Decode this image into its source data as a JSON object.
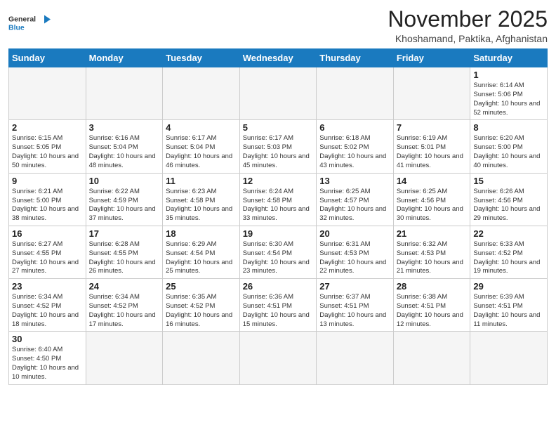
{
  "header": {
    "logo_general": "General",
    "logo_blue": "Blue",
    "month_title": "November 2025",
    "location": "Khoshamand, Paktika, Afghanistan"
  },
  "days_of_week": [
    "Sunday",
    "Monday",
    "Tuesday",
    "Wednesday",
    "Thursday",
    "Friday",
    "Saturday"
  ],
  "weeks": [
    [
      {
        "day": "",
        "info": ""
      },
      {
        "day": "",
        "info": ""
      },
      {
        "day": "",
        "info": ""
      },
      {
        "day": "",
        "info": ""
      },
      {
        "day": "",
        "info": ""
      },
      {
        "day": "",
        "info": ""
      },
      {
        "day": "1",
        "info": "Sunrise: 6:14 AM\nSunset: 5:06 PM\nDaylight: 10 hours and 52 minutes."
      }
    ],
    [
      {
        "day": "2",
        "info": "Sunrise: 6:15 AM\nSunset: 5:05 PM\nDaylight: 10 hours and 50 minutes."
      },
      {
        "day": "3",
        "info": "Sunrise: 6:16 AM\nSunset: 5:04 PM\nDaylight: 10 hours and 48 minutes."
      },
      {
        "day": "4",
        "info": "Sunrise: 6:17 AM\nSunset: 5:04 PM\nDaylight: 10 hours and 46 minutes."
      },
      {
        "day": "5",
        "info": "Sunrise: 6:17 AM\nSunset: 5:03 PM\nDaylight: 10 hours and 45 minutes."
      },
      {
        "day": "6",
        "info": "Sunrise: 6:18 AM\nSunset: 5:02 PM\nDaylight: 10 hours and 43 minutes."
      },
      {
        "day": "7",
        "info": "Sunrise: 6:19 AM\nSunset: 5:01 PM\nDaylight: 10 hours and 41 minutes."
      },
      {
        "day": "8",
        "info": "Sunrise: 6:20 AM\nSunset: 5:00 PM\nDaylight: 10 hours and 40 minutes."
      }
    ],
    [
      {
        "day": "9",
        "info": "Sunrise: 6:21 AM\nSunset: 5:00 PM\nDaylight: 10 hours and 38 minutes."
      },
      {
        "day": "10",
        "info": "Sunrise: 6:22 AM\nSunset: 4:59 PM\nDaylight: 10 hours and 37 minutes."
      },
      {
        "day": "11",
        "info": "Sunrise: 6:23 AM\nSunset: 4:58 PM\nDaylight: 10 hours and 35 minutes."
      },
      {
        "day": "12",
        "info": "Sunrise: 6:24 AM\nSunset: 4:58 PM\nDaylight: 10 hours and 33 minutes."
      },
      {
        "day": "13",
        "info": "Sunrise: 6:25 AM\nSunset: 4:57 PM\nDaylight: 10 hours and 32 minutes."
      },
      {
        "day": "14",
        "info": "Sunrise: 6:25 AM\nSunset: 4:56 PM\nDaylight: 10 hours and 30 minutes."
      },
      {
        "day": "15",
        "info": "Sunrise: 6:26 AM\nSunset: 4:56 PM\nDaylight: 10 hours and 29 minutes."
      }
    ],
    [
      {
        "day": "16",
        "info": "Sunrise: 6:27 AM\nSunset: 4:55 PM\nDaylight: 10 hours and 27 minutes."
      },
      {
        "day": "17",
        "info": "Sunrise: 6:28 AM\nSunset: 4:55 PM\nDaylight: 10 hours and 26 minutes."
      },
      {
        "day": "18",
        "info": "Sunrise: 6:29 AM\nSunset: 4:54 PM\nDaylight: 10 hours and 25 minutes."
      },
      {
        "day": "19",
        "info": "Sunrise: 6:30 AM\nSunset: 4:54 PM\nDaylight: 10 hours and 23 minutes."
      },
      {
        "day": "20",
        "info": "Sunrise: 6:31 AM\nSunset: 4:53 PM\nDaylight: 10 hours and 22 minutes."
      },
      {
        "day": "21",
        "info": "Sunrise: 6:32 AM\nSunset: 4:53 PM\nDaylight: 10 hours and 21 minutes."
      },
      {
        "day": "22",
        "info": "Sunrise: 6:33 AM\nSunset: 4:52 PM\nDaylight: 10 hours and 19 minutes."
      }
    ],
    [
      {
        "day": "23",
        "info": "Sunrise: 6:34 AM\nSunset: 4:52 PM\nDaylight: 10 hours and 18 minutes."
      },
      {
        "day": "24",
        "info": "Sunrise: 6:34 AM\nSunset: 4:52 PM\nDaylight: 10 hours and 17 minutes."
      },
      {
        "day": "25",
        "info": "Sunrise: 6:35 AM\nSunset: 4:52 PM\nDaylight: 10 hours and 16 minutes."
      },
      {
        "day": "26",
        "info": "Sunrise: 6:36 AM\nSunset: 4:51 PM\nDaylight: 10 hours and 15 minutes."
      },
      {
        "day": "27",
        "info": "Sunrise: 6:37 AM\nSunset: 4:51 PM\nDaylight: 10 hours and 13 minutes."
      },
      {
        "day": "28",
        "info": "Sunrise: 6:38 AM\nSunset: 4:51 PM\nDaylight: 10 hours and 12 minutes."
      },
      {
        "day": "29",
        "info": "Sunrise: 6:39 AM\nSunset: 4:51 PM\nDaylight: 10 hours and 11 minutes."
      }
    ],
    [
      {
        "day": "30",
        "info": "Sunrise: 6:40 AM\nSunset: 4:50 PM\nDaylight: 10 hours and 10 minutes."
      },
      {
        "day": "",
        "info": ""
      },
      {
        "day": "",
        "info": ""
      },
      {
        "day": "",
        "info": ""
      },
      {
        "day": "",
        "info": ""
      },
      {
        "day": "",
        "info": ""
      },
      {
        "day": "",
        "info": ""
      }
    ]
  ]
}
